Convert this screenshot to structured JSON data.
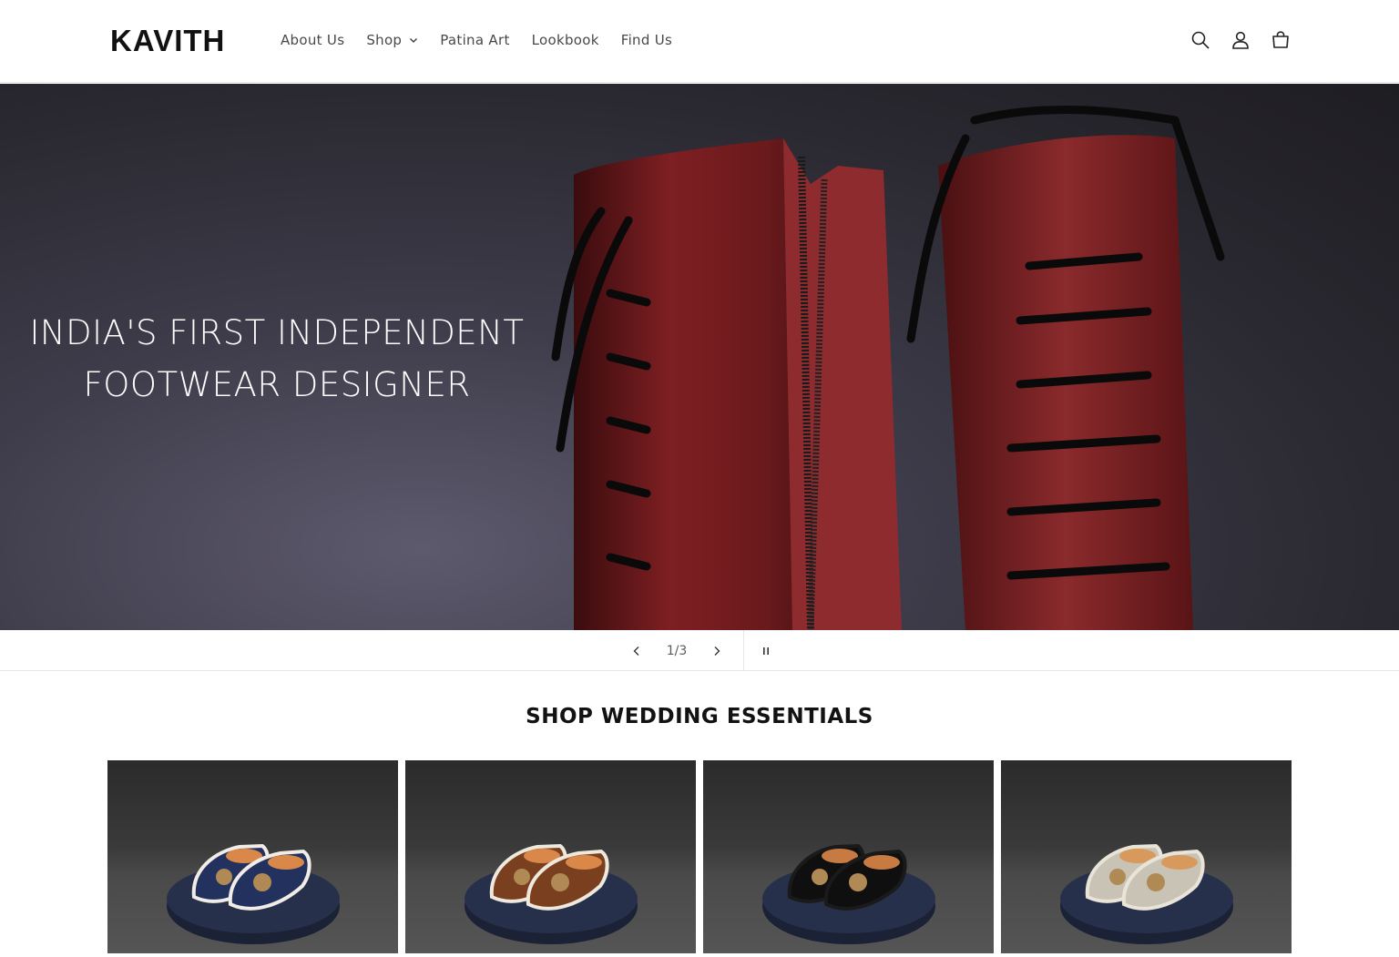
{
  "header": {
    "logo": "KAVITH",
    "nav": [
      {
        "label": "About Us"
      },
      {
        "label": "Shop",
        "has_dropdown": true
      },
      {
        "label": "Patina Art"
      },
      {
        "label": "Lookbook"
      },
      {
        "label": "Find Us"
      }
    ],
    "icons": [
      "search-icon",
      "account-icon",
      "cart-icon"
    ]
  },
  "hero": {
    "line1": "INDIA'S FIRST INDEPENDENT",
    "line2": "FOOTWEAR DESIGNER"
  },
  "slider": {
    "counter": "1/3",
    "current": 1,
    "total": 3,
    "prev_icon": "chevron-left-icon",
    "next_icon": "chevron-right-icon",
    "pause_icon": "pause-icon"
  },
  "section": {
    "title": "SHOP WEDDING ESSENTIALS",
    "products": [
      {
        "color": "#22315e",
        "sole": "#f1ede6",
        "lining": "#d9884a"
      },
      {
        "color": "#7a3f1e",
        "sole": "#efe8dc",
        "lining": "#d9884a"
      },
      {
        "color": "#0f0f10",
        "sole": "#1a1a1a",
        "lining": "#c77a42"
      },
      {
        "color": "#c9c3b6",
        "sole": "#e9e4d8",
        "lining": "#d79a5c"
      }
    ]
  },
  "colors": {
    "hero_bg": "#2a2830",
    "boot_red": "#7e1f22"
  }
}
